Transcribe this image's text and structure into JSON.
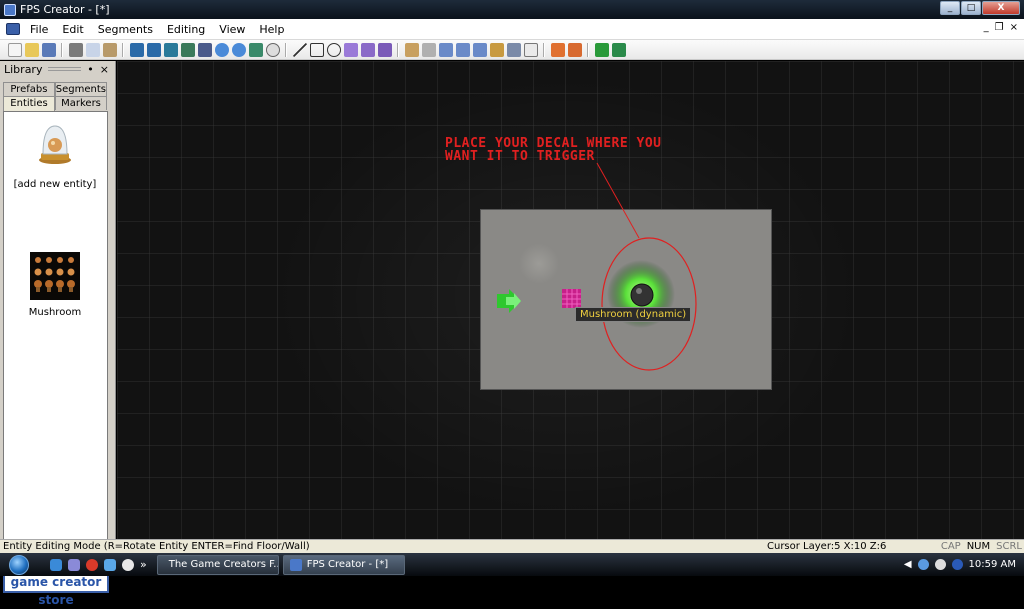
{
  "window": {
    "title": "FPS Creator - [*]"
  },
  "menu": [
    "File",
    "Edit",
    "Segments",
    "Editing",
    "View",
    "Help"
  ],
  "mdi_controls": {
    "minimize": "_",
    "restore": "❐",
    "close": "×"
  },
  "library": {
    "title": "Library",
    "pin": "•",
    "close": "×",
    "tabs_row1": [
      "Prefabs",
      "Segments"
    ],
    "tabs_row2": [
      "Entities",
      "Markers"
    ],
    "entities": [
      {
        "label": "[add new entity]",
        "icon": "dome-icon"
      },
      {
        "label": "Mushroom",
        "icon": "mushroom-grid-icon"
      }
    ],
    "store_button": "game creator store"
  },
  "viewport": {
    "annotation": "PLACE YOUR DECAL WHERE YOU WANT IT TO TRIGGER",
    "annotation_line1": "PLACE YOUR DECAL WHERE YOU",
    "annotation_line2": "WANT IT TO TRIGGER",
    "entity_tooltip": "Mushroom (dynamic)",
    "annotation_color": "#e02020"
  },
  "status": {
    "mode": "Entity Editing Mode (R=Rotate Entity  ENTER=Find Floor/Wall)",
    "cursor": "Cursor Layer:5  X:10  Z:6",
    "caps": "CAP",
    "num": "NUM",
    "scrl": "SCRL"
  },
  "taskbar": {
    "tasks": [
      {
        "label": "The Game Creators F..."
      },
      {
        "label": "FPS Creator - [*]"
      }
    ],
    "chevron": "»",
    "clock": "10:59 AM"
  },
  "colors": {
    "accent": "#3a5fa8",
    "taskbar": "#1a222c"
  }
}
